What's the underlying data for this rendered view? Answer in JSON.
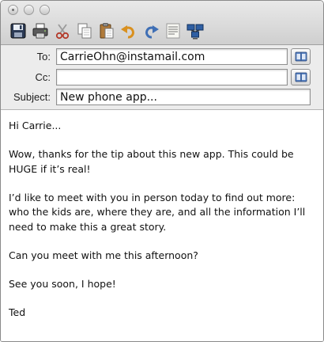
{
  "toolbar": {
    "buttons": [
      {
        "name": "save",
        "icon": "floppy-disk-icon"
      },
      {
        "name": "print",
        "icon": "printer-icon"
      },
      {
        "name": "cut",
        "icon": "scissors-icon"
      },
      {
        "name": "copy",
        "icon": "copy-icon"
      },
      {
        "name": "paste",
        "icon": "clipboard-icon"
      },
      {
        "name": "undo",
        "icon": "undo-arrow-icon"
      },
      {
        "name": "redo",
        "icon": "redo-arrow-icon"
      },
      {
        "name": "format",
        "icon": "text-format-icon"
      },
      {
        "name": "network",
        "icon": "network-computers-icon"
      }
    ]
  },
  "header": {
    "to_label": "To:",
    "to_value": "CarrieOhn@instamail.com",
    "cc_label": "Cc:",
    "cc_value": "",
    "subject_label": "Subject:",
    "subject_value": "New phone app..."
  },
  "message": {
    "greeting": "Hi Carrie...",
    "para1": "Wow, thanks for the tip about this new app. This could be HUGE if it’s real!",
    "para2": "I’d like to meet with you in person today to find out more: who the kids are, where they are, and all the information I’ll need to make this a great story.",
    "para3": "Can you meet with me this afternoon?",
    "para4": "See you soon, I hope!",
    "signature": "Ted"
  },
  "colors": {
    "chrome_top": "#e9e9e9",
    "chrome_bottom": "#cfcfcf",
    "header_bg": "#ececec",
    "body_bg": "#ffffff"
  }
}
